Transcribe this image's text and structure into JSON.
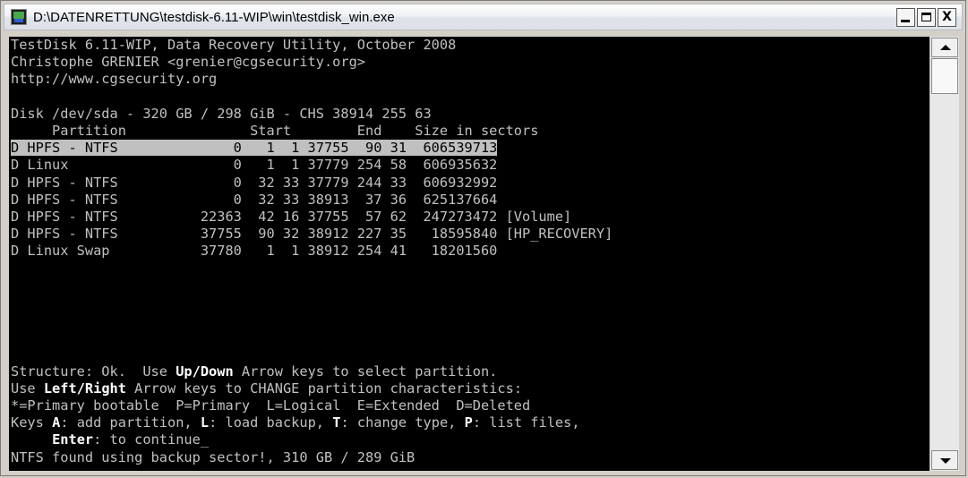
{
  "window": {
    "title": "D:\\DATENRETTUNG\\testdisk-6.11-WIP\\win\\testdisk_win.exe",
    "controls": {
      "minimize": "_",
      "maximize": "□",
      "close": "X"
    }
  },
  "console": {
    "header": [
      "TestDisk 6.11-WIP, Data Recovery Utility, October 2008",
      "Christophe GRENIER <grenier@cgsecurity.org>",
      "http://www.cgsecurity.org"
    ],
    "disk_line": "Disk /dev/sda - 320 GB / 298 GiB - CHS 38914 255 63",
    "columns_line": "     Partition               Start        End    Size in sectors",
    "partitions": [
      {
        "selected": true,
        "row": "D HPFS - NTFS              0   1  1 37755  90 31  606539713",
        "label": ""
      },
      {
        "selected": false,
        "row": "D Linux                    0   1  1 37779 254 58  606935632",
        "label": ""
      },
      {
        "selected": false,
        "row": "D HPFS - NTFS              0  32 33 37779 244 33  606932992",
        "label": ""
      },
      {
        "selected": false,
        "row": "D HPFS - NTFS              0  32 33 38913  37 36  625137664",
        "label": ""
      },
      {
        "selected": false,
        "row": "D HPFS - NTFS          22363  42 16 37755  57 62  247273472",
        "label": " [Volume]"
      },
      {
        "selected": false,
        "row": "D HPFS - NTFS          37755  90 32 38912 227 35   18595840",
        "label": " [HP_RECOVERY]"
      },
      {
        "selected": false,
        "row": "D Linux Swap           37780   1  1 38912 254 41   18201560",
        "label": ""
      }
    ],
    "help": {
      "l1_a": "Structure: Ok.  Use ",
      "l1_b": "Up",
      "l1_c": "/",
      "l1_d": "Down",
      "l1_e": " Arrow keys to select partition.",
      "l2_a": "Use ",
      "l2_b": "Left",
      "l2_c": "/",
      "l2_d": "Right",
      "l2_e": " Arrow keys to CHANGE partition characteristics:",
      "l3": "*=Primary bootable  P=Primary  L=Logical  E=Extended  D=Deleted",
      "l4_a": "Keys ",
      "l4_b": "A",
      "l4_c": ": add partition, ",
      "l4_d": "L",
      "l4_e": ": load backup, ",
      "l4_f": "T",
      "l4_g": ": change type, ",
      "l4_h": "P",
      "l4_i": ": list files,",
      "l5_a": "     ",
      "l5_b": "Enter",
      "l5_c": ": to continue",
      "cursor": "_",
      "status": "NTFS found using backup sector!, 310 GB / 289 GiB"
    }
  }
}
